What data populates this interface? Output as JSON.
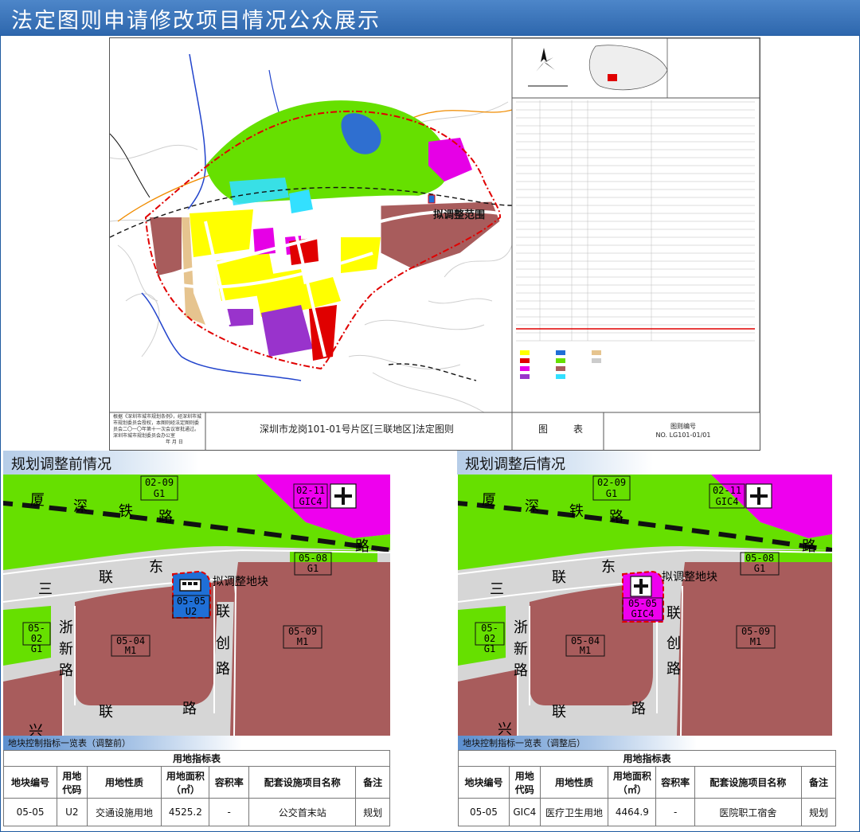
{
  "page": {
    "title": "法定图则申请修改项目情况公众展示"
  },
  "plan": {
    "name": "深圳市龙岗101-01号片区[三联地区]法定图则",
    "label_tu": "图",
    "label_biao": "表",
    "number_label": "图则编号",
    "number": "NO. LG101-01/01",
    "adjust_area_label": "拟调整范围",
    "stamp_text": "根据《深圳市城市规划条例》，经深圳市城市规划委员会授权，本图则经法定图则委员会二〇一〇年第十一次会议审批通过。深圳市城市规划委员会办公室",
    "date_text": "年 月 日"
  },
  "before": {
    "heading": "规划调整前情况",
    "road_labels": [
      "厦",
      "深",
      "铁",
      "路",
      "三",
      "联",
      "东",
      "路",
      "联",
      "创",
      "路",
      "联",
      "路",
      "浙",
      "新",
      "路",
      "兴"
    ],
    "adjust_label": "拟调整地块",
    "parcels": [
      {
        "code": "02-09",
        "use": "G1"
      },
      {
        "code": "02-11",
        "use": "GIC4"
      },
      {
        "code": "05-08",
        "use": "G1"
      },
      {
        "code": "05-05",
        "use": "U2"
      },
      {
        "code": "05-02",
        "use": "G1"
      },
      {
        "code": "05-04",
        "use": "M1"
      },
      {
        "code": "05-09",
        "use": "M1"
      }
    ],
    "table_caption": "地块控制指标一览表（调整前）",
    "table_title": "用地指标表",
    "headers": [
      "地块编号",
      "用地代码",
      "用地性质",
      "用地面积（㎡）",
      "容积率",
      "配套设施项目名称",
      "备注"
    ],
    "row": [
      "05-05",
      "U2",
      "交通设施用地",
      "4525.2",
      "-",
      "公交首末站",
      "规划"
    ]
  },
  "after": {
    "heading": "规划调整后情况",
    "road_labels": [
      "厦",
      "深",
      "铁",
      "路",
      "三",
      "联",
      "东",
      "路",
      "联",
      "创",
      "路",
      "联",
      "路",
      "浙",
      "新",
      "路",
      "兴"
    ],
    "adjust_label": "拟调整地块",
    "parcels": [
      {
        "code": "02-09",
        "use": "G1"
      },
      {
        "code": "02-11",
        "use": "GIC4"
      },
      {
        "code": "05-08",
        "use": "G1"
      },
      {
        "code": "05-05",
        "use": "GIC4"
      },
      {
        "code": "05-02",
        "use": "G1"
      },
      {
        "code": "05-04",
        "use": "M1"
      },
      {
        "code": "05-09",
        "use": "M1"
      }
    ],
    "table_caption": "地块控制指标一览表（调整后）",
    "table_title": "用地指标表",
    "headers": [
      "地块编号",
      "用地代码",
      "用地性质",
      "用地面积（㎡）",
      "容积率",
      "配套设施项目名称",
      "备注"
    ],
    "row": [
      "05-05",
      "GIC4",
      "医疗卫生用地",
      "4464.9",
      "-",
      "医院职工宿舍",
      "规划"
    ]
  },
  "colors": {
    "title_bar": "#3a73b8",
    "industrial_M1": "#a85c5c",
    "green_G1": "#66e000",
    "gic4": "#ee00ee",
    "transport_U2": "#1f6fd6",
    "road": "#d8d8d8",
    "residential": "#ffff00",
    "education": "#9933cc",
    "commercial": "#e00000",
    "adjust_boundary": "#e00000"
  }
}
